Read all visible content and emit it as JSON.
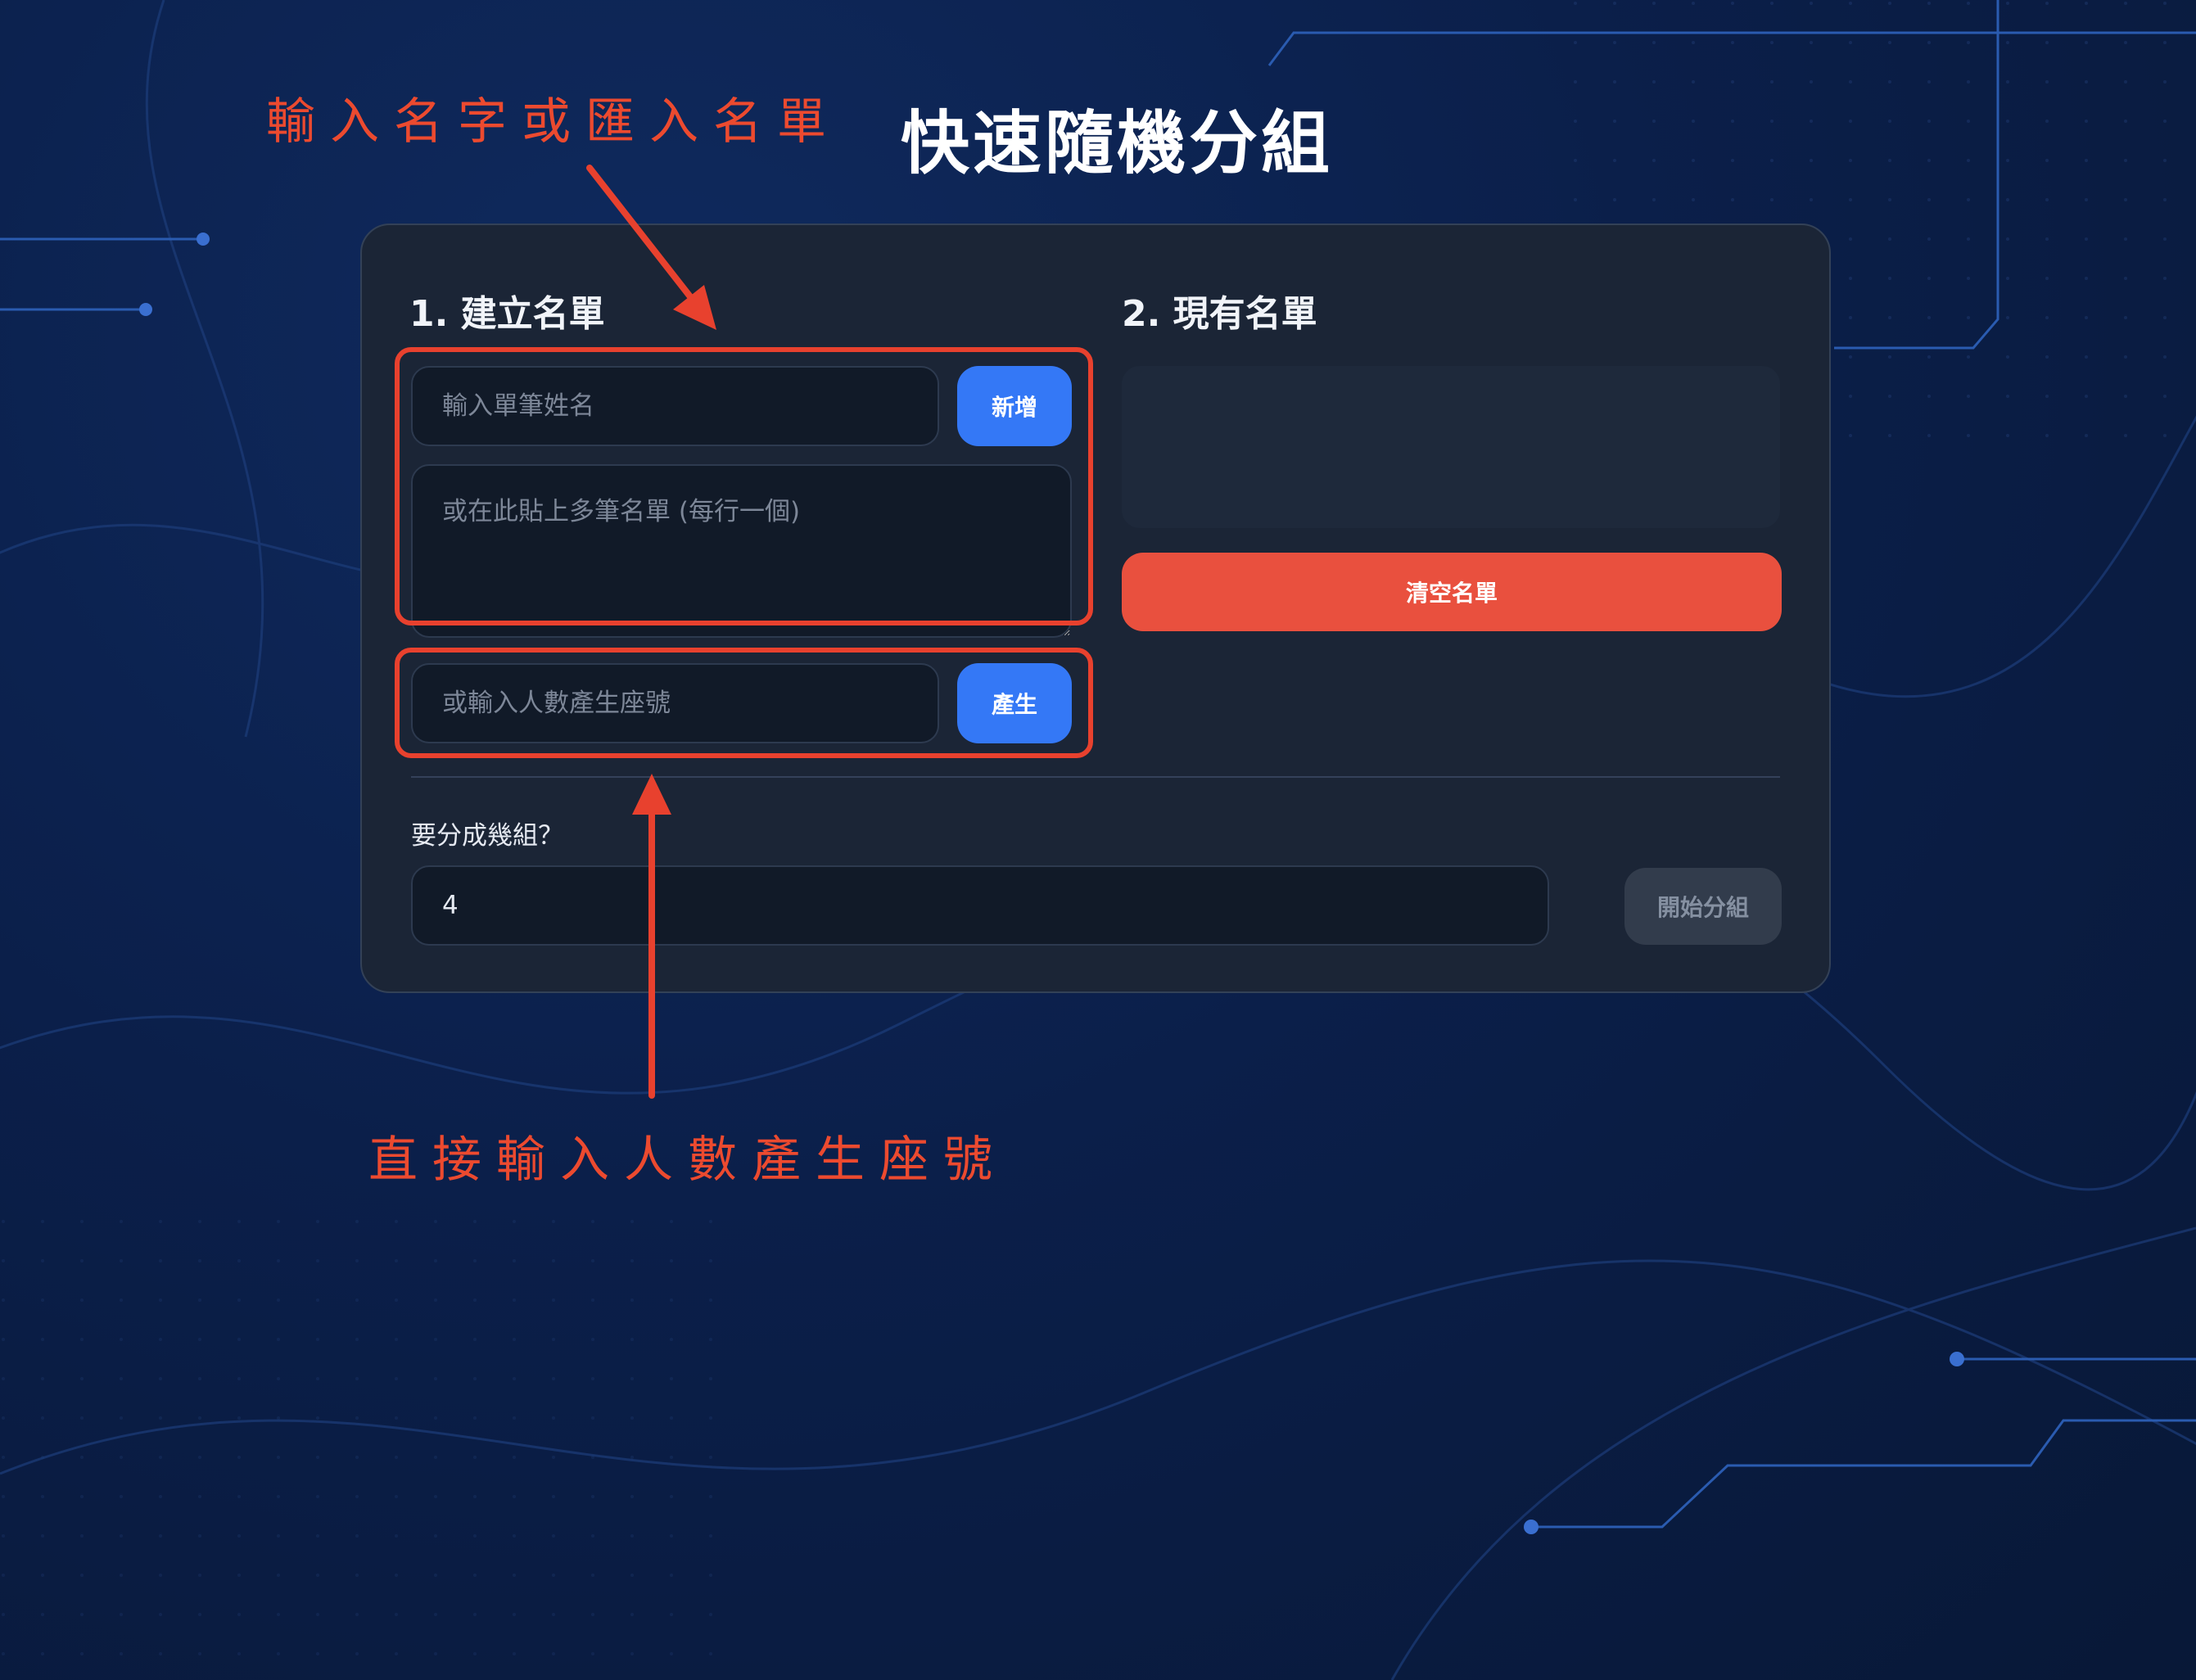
{
  "header": {
    "title": "快速隨機分組"
  },
  "build_list": {
    "title": "1. 建立名單",
    "name_placeholder": "輸入單筆姓名",
    "add_label": "新增",
    "bulk_placeholder": "或在此貼上多筆名單 (每行一個)",
    "count_placeholder": "或輸入人數產生座號",
    "generate_label": "產生"
  },
  "current_list": {
    "title": "2. 現有名單",
    "clear_label": "清空名單"
  },
  "grouping": {
    "label": "要分成幾組？",
    "group_count": "4",
    "start_label": "開始分組"
  },
  "annotations": {
    "top": "輸入名字或匯入名單",
    "bottom": "直接輸入人數產生座號"
  },
  "colors": {
    "accent_blue": "#3478f6",
    "danger_red": "#e9503e",
    "annotation_red": "#e8412e",
    "card_bg": "#1b2536"
  }
}
